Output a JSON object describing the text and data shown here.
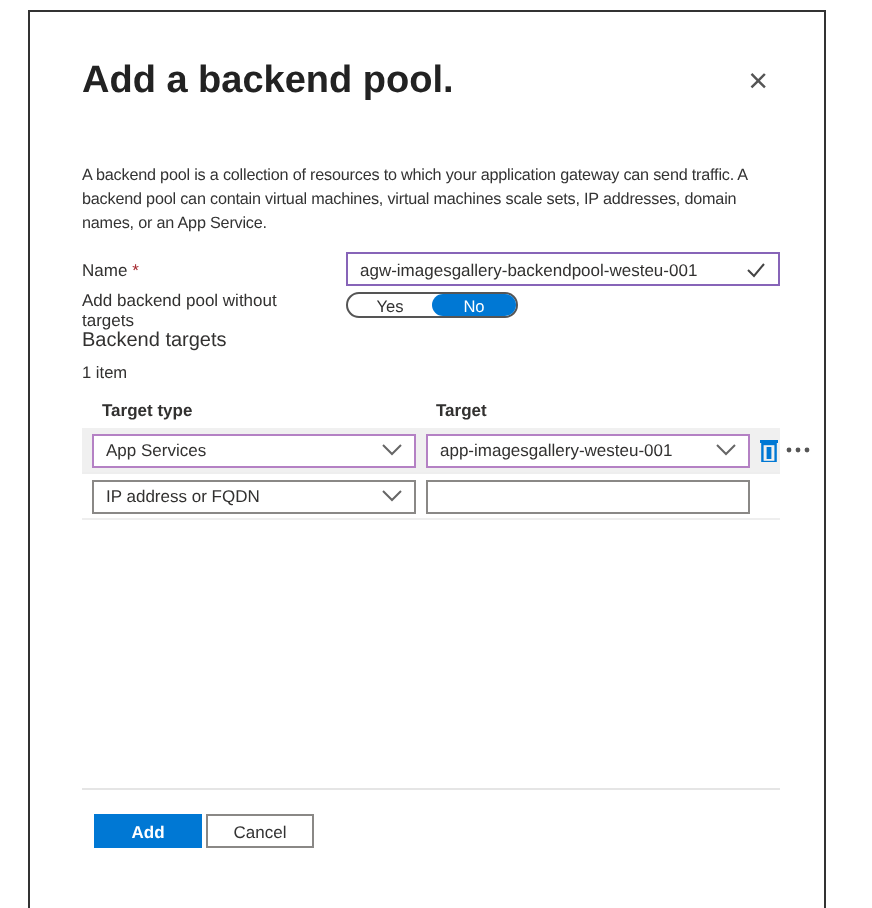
{
  "dialog": {
    "title": "Add a backend pool.",
    "close": "×"
  },
  "description": "A backend pool is a collection of resources to which your application gateway can send traffic. A backend pool can contain virtual machines, virtual machines scale sets, IP addresses, domain names, or an App Service.",
  "name_field": {
    "label": "Name",
    "required_mark": "*",
    "value": "agw-imagesgallery-backendpool-westeu-001",
    "valid": true
  },
  "without_targets": {
    "label": "Add backend pool without targets",
    "options": [
      {
        "label": "Yes",
        "selected": false
      },
      {
        "label": "No",
        "selected": true
      }
    ]
  },
  "section_title": "Backend targets",
  "item_count": "1 item",
  "table": {
    "columns": [
      "Target type",
      "Target"
    ],
    "rows": [
      {
        "selected": true,
        "type": "App Services",
        "target": "app-imagesgallery-westeu-001",
        "actions": true
      },
      {
        "selected": false,
        "type": "IP address or FQDN",
        "target": null,
        "actions": false
      }
    ]
  },
  "buttons": [
    {
      "label": "Add",
      "kind": "primary"
    },
    {
      "label": "Cancel",
      "kind": "secondary"
    }
  ]
}
